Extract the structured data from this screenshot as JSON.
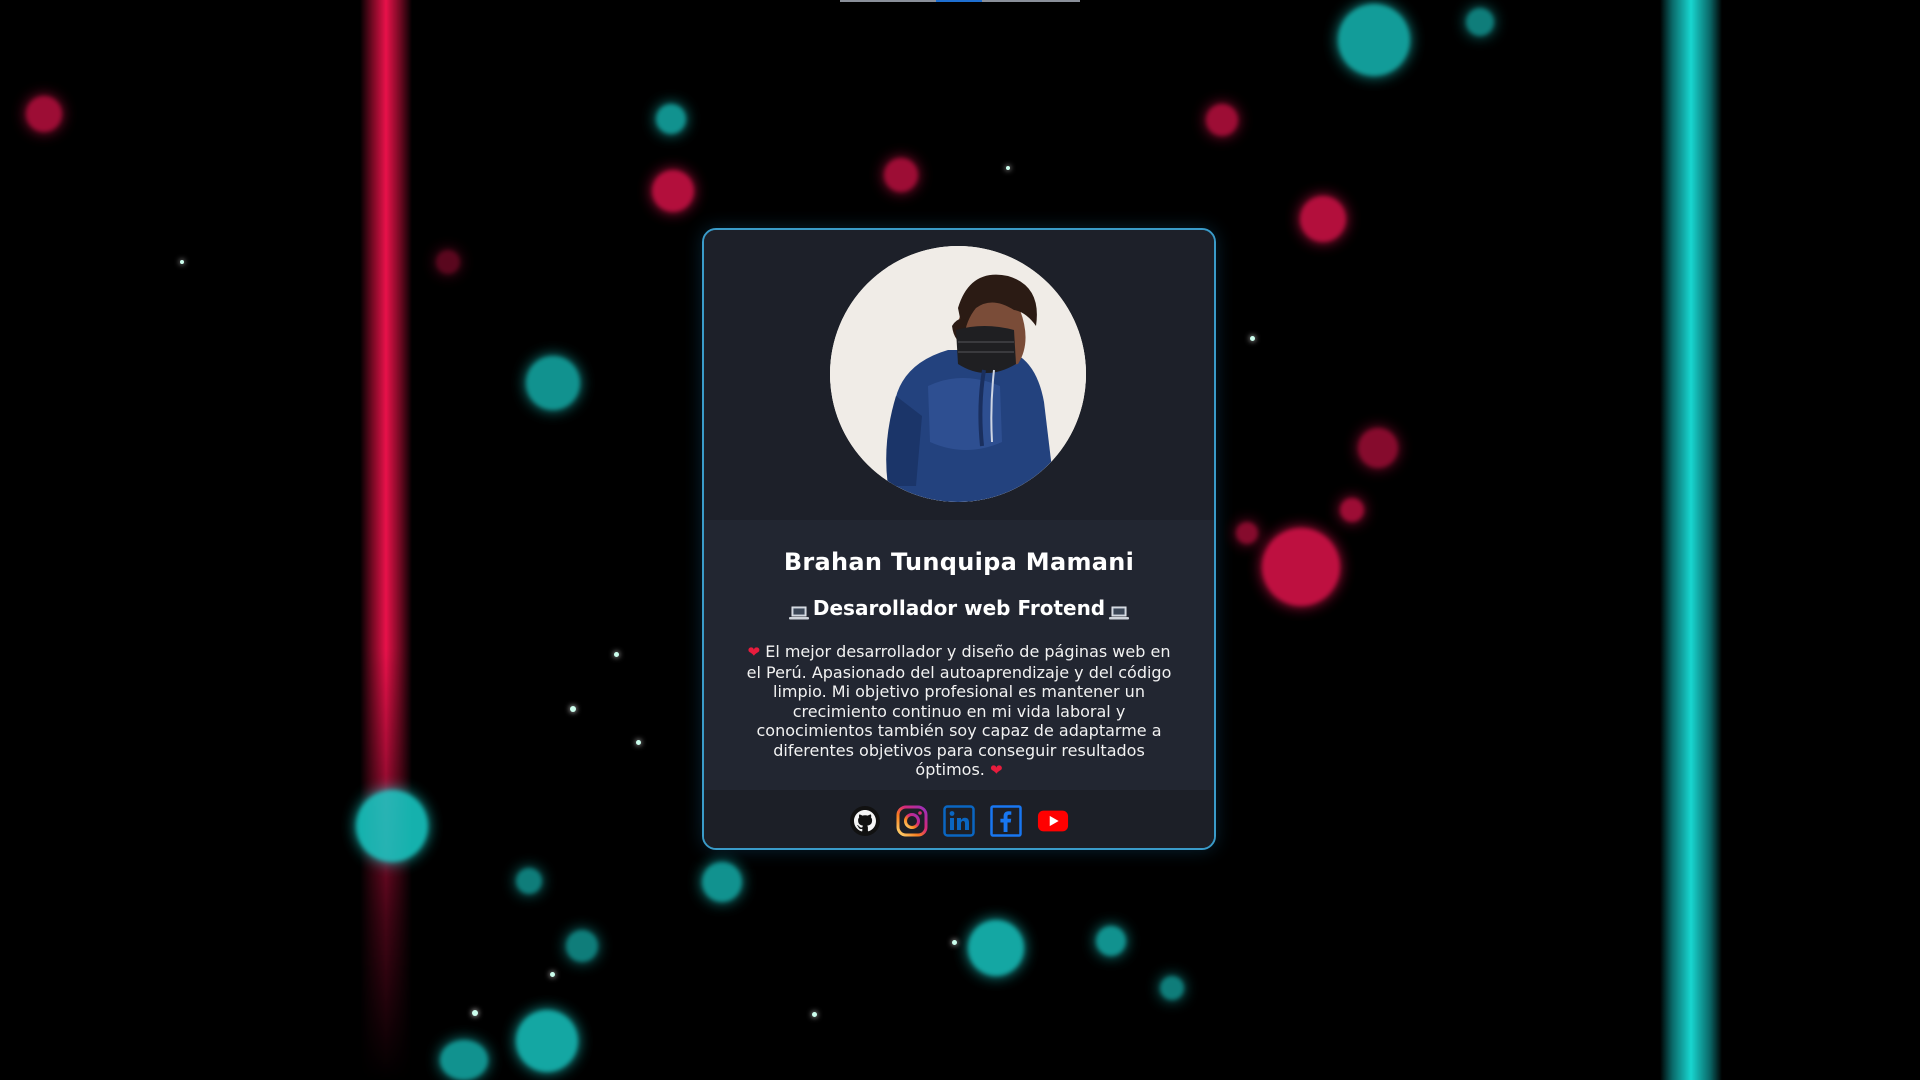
{
  "profile": {
    "name": "Brahan Tunquipa Mamani",
    "role": "Desarollador web Frotend",
    "bio": "El mejor desarrollador y diseño de páginas web en el Perú. Apasionado del autoaprendizaje y del código limpio. Mi objetivo profesional es mantener un crecimiento continuo en mi vida laboral y conocimientos también soy capaz de adaptarme a diferentes objetivos para conseguir resultados óptimos."
  },
  "social": [
    {
      "icon": "github-icon"
    },
    {
      "icon": "instagram-icon"
    },
    {
      "icon": "linkedin-icon"
    },
    {
      "icon": "facebook-icon"
    },
    {
      "icon": "youtube-icon"
    }
  ],
  "colors": {
    "card_border": "#3a9bc9",
    "accent_red": "#e0134c",
    "accent_teal": "#19d1cc",
    "heart": "#e81c3d",
    "youtube": "#ff0000",
    "linkedin": "#0a66c2",
    "facebook": "#1877f2"
  }
}
